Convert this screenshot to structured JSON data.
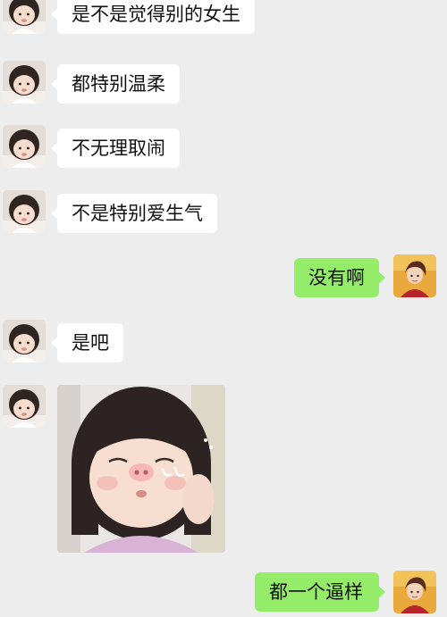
{
  "chat": {
    "messages": [
      {
        "sender": "other",
        "text": "是不是觉得别的女生"
      },
      {
        "sender": "other",
        "text": "都特别温柔"
      },
      {
        "sender": "other",
        "text": "不无理取闹"
      },
      {
        "sender": "other",
        "text": "不是特别爱生气"
      },
      {
        "sender": "self",
        "text": "没有啊"
      },
      {
        "sender": "other",
        "text": "是吧"
      },
      {
        "sender": "other",
        "type": "sticker"
      },
      {
        "sender": "self",
        "text": "都一个逼样"
      }
    ]
  },
  "colors": {
    "background": "#ededed",
    "incoming_bubble": "#ffffff",
    "outgoing_bubble": "#95ec69"
  },
  "icons": {
    "other_avatar": "girl-avatar-icon",
    "self_avatar": "anime-avatar-icon"
  }
}
